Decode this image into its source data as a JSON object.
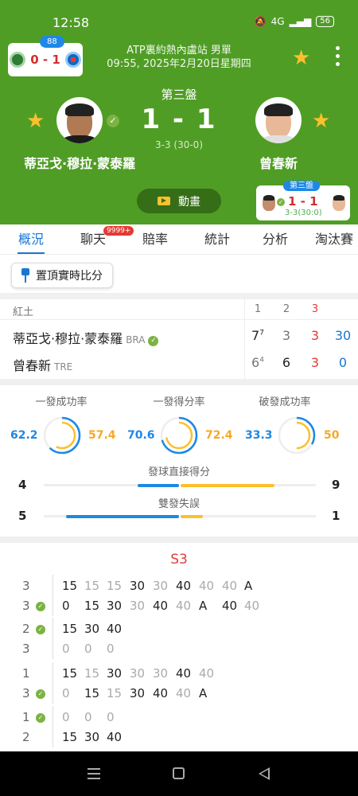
{
  "status_bar": {
    "time": "12:58",
    "network": "4G",
    "battery": "56"
  },
  "header": {
    "mini_score": {
      "badge": "88",
      "score": "0 - 1"
    },
    "tournament": "ATP裏約熱內盧站 男單",
    "datetime": "09:55, 2025年2月20日星期四",
    "set_label": "第三盤",
    "score": "1 - 1",
    "game_score": "3-3 (30-0)",
    "player1": {
      "name": "蒂亞戈·穆拉·蒙泰羅",
      "country": "BRA",
      "serving": true
    },
    "player2": {
      "name": "曾春新",
      "country": "TRE"
    },
    "animation_label": "動畫",
    "live_card": {
      "badge": "第三盤",
      "score": "1 - 1",
      "game": "3-3(30:0)"
    }
  },
  "tabs": [
    {
      "label": "概況",
      "active": true
    },
    {
      "label": "聊天",
      "badge": "9999+"
    },
    {
      "label": "賠率"
    },
    {
      "label": "統計"
    },
    {
      "label": "分析"
    },
    {
      "label": "淘汰賽"
    }
  ],
  "pin_label": "置頂實時比分",
  "scoreboard": {
    "surface": "紅土",
    "set_headers": [
      "1",
      "2",
      "3"
    ],
    "rows": [
      {
        "name": "蒂亞戈·穆拉·蒙泰羅",
        "country": "BRA",
        "s1": "7",
        "s1_tb": "7",
        "s2": "3",
        "s3": "3",
        "points": "30"
      },
      {
        "name": "曾春新",
        "country": "TRE",
        "s1": "6",
        "s1_tb": "4",
        "s2": "6",
        "s3": "3",
        "points": "0"
      }
    ]
  },
  "stats": {
    "colors": {
      "player1": "#1e88e5",
      "player2": "#fbc02d"
    },
    "gauges": [
      {
        "title": "一發成功率",
        "p1": "62.2",
        "p2": "57.4",
        "p1_value": 62.2,
        "p2_value": 57.4
      },
      {
        "title": "一發得分率",
        "p1": "70.6",
        "p2": "72.4",
        "p1_value": 70.6,
        "p2_value": 72.4
      },
      {
        "title": "破發成功率",
        "p1": "33.3",
        "p2": "50",
        "p1_value": 33.3,
        "p2_value": 50
      }
    ],
    "bars": [
      {
        "title": "發球直接得分",
        "p1": "4",
        "p2": "9",
        "p1_value": 4,
        "p2_value": 9
      },
      {
        "title": "雙發失誤",
        "p1": "5",
        "p2": "1",
        "p1_value": 5,
        "p2_value": 1
      }
    ]
  },
  "point_by_point": {
    "title": "S3",
    "games": [
      {
        "p1_games": "3",
        "p2_games": "3",
        "server": 2,
        "p1_points": [
          [
            "15",
            false
          ],
          [
            "15",
            true
          ],
          [
            "15",
            true
          ],
          [
            "30",
            false
          ],
          [
            "30",
            true
          ],
          [
            "40",
            false
          ],
          [
            "40",
            true
          ],
          [
            "40",
            true
          ],
          [
            "A",
            false
          ]
        ],
        "p2_points": [
          [
            "0",
            false
          ],
          [
            "15",
            false
          ],
          [
            "30",
            false
          ],
          [
            "30",
            true
          ],
          [
            "40",
            false
          ],
          [
            "40",
            true
          ],
          [
            "A",
            false
          ],
          [
            "40",
            false
          ],
          [
            "40",
            true
          ]
        ]
      },
      {
        "p1_games": "2",
        "p2_games": "3",
        "server": 1,
        "p1_points": [
          [
            "15",
            false
          ],
          [
            "30",
            false
          ],
          [
            "40",
            false
          ]
        ],
        "p2_points": [
          [
            "0",
            true
          ],
          [
            "0",
            true
          ],
          [
            "0",
            true
          ]
        ]
      },
      {
        "p1_games": "1",
        "p2_games": "3",
        "server": 2,
        "p1_points": [
          [
            "15",
            false
          ],
          [
            "15",
            true
          ],
          [
            "30",
            false
          ],
          [
            "30",
            true
          ],
          [
            "30",
            true
          ],
          [
            "40",
            false
          ],
          [
            "40",
            true
          ]
        ],
        "p2_points": [
          [
            "0",
            true
          ],
          [
            "15",
            false
          ],
          [
            "15",
            true
          ],
          [
            "30",
            false
          ],
          [
            "40",
            false
          ],
          [
            "40",
            true
          ],
          [
            "A",
            false
          ]
        ]
      },
      {
        "p1_games": "1",
        "p2_games": "2",
        "server": 1,
        "p1_points": [
          [
            "0",
            true
          ],
          [
            "0",
            true
          ],
          [
            "0",
            true
          ]
        ],
        "p2_points": [
          [
            "15",
            false
          ],
          [
            "30",
            false
          ],
          [
            "40",
            false
          ]
        ]
      }
    ]
  }
}
